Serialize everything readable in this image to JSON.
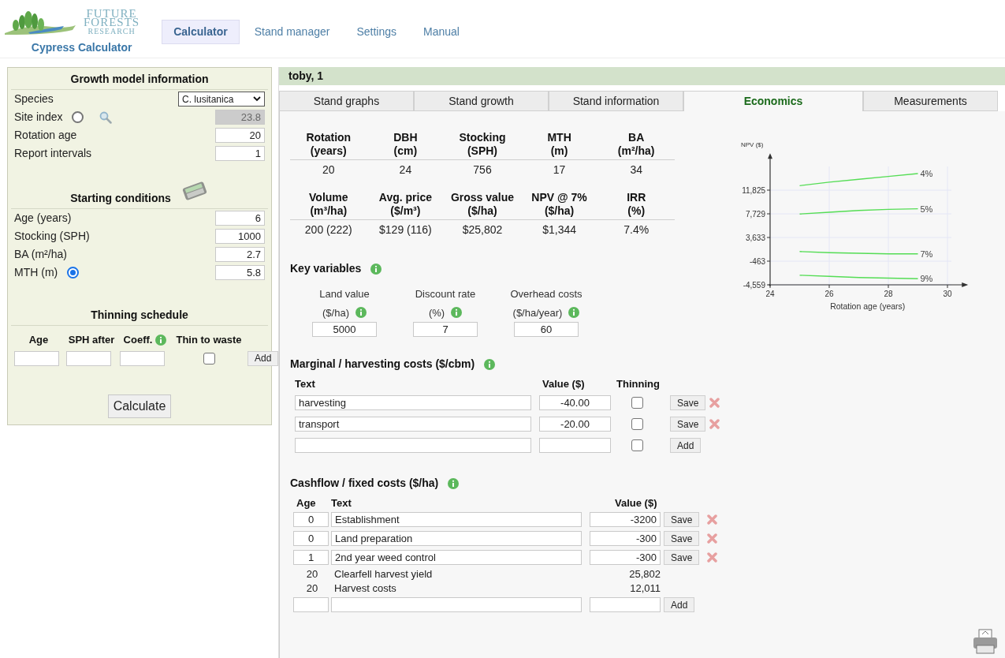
{
  "header": {
    "logo_text": [
      "FUTURE",
      "FORESTS",
      "RESEARCH"
    ],
    "app_title": "Cypress Calculator",
    "nav": [
      {
        "label": "Calculator",
        "selected": true
      },
      {
        "label": "Stand manager",
        "selected": false
      },
      {
        "label": "Settings",
        "selected": false
      },
      {
        "label": "Manual",
        "selected": false
      }
    ]
  },
  "growth_model": {
    "title": "Growth model information",
    "rows": [
      {
        "kind": "select",
        "label": "Species",
        "value": "C. lusitanica"
      },
      {
        "kind": "radio",
        "label": "Site index",
        "selected": false,
        "value": "23.8",
        "search": true
      },
      {
        "kind": "input",
        "label": "Rotation age",
        "value": "20"
      },
      {
        "kind": "input",
        "label": "Report intervals",
        "value": "1"
      }
    ]
  },
  "starting_conditions": {
    "title": "Starting conditions",
    "rows": [
      {
        "kind": "input",
        "label": "Age (years)",
        "value": "6"
      },
      {
        "kind": "input",
        "label": "Stocking (SPH)",
        "value": "1000"
      },
      {
        "kind": "input",
        "label": "BA (m²/ha)",
        "value": "2.7"
      },
      {
        "kind": "radio",
        "label": "MTH (m)",
        "selected": true,
        "value": "5.8"
      }
    ]
  },
  "thinning_schedule": {
    "title": "Thinning schedule",
    "columns": [
      "Age",
      "SPH after",
      "Coeff.",
      "Thin to waste"
    ],
    "thin_to_waste": false,
    "add": "Add"
  },
  "calculate": "Calculate",
  "stand": {
    "title": "toby, 1",
    "tabs": [
      {
        "label": "Stand graphs",
        "selected": false
      },
      {
        "label": "Stand growth",
        "selected": false
      },
      {
        "label": "Stand information",
        "selected": false
      },
      {
        "label": "Economics",
        "selected": true
      },
      {
        "label": "Measurements",
        "selected": false
      }
    ],
    "summary": [
      [
        {
          "heading": [
            "Rotation",
            "(years)"
          ],
          "value": "20"
        },
        {
          "heading": [
            "DBH",
            "(cm)"
          ],
          "value": "24"
        },
        {
          "heading": [
            "Stocking",
            "(SPH)"
          ],
          "value": "756"
        },
        {
          "heading": [
            "MTH",
            "(m)"
          ],
          "value": "17"
        },
        {
          "heading": [
            "BA",
            "(m²/ha)"
          ],
          "value": "34"
        }
      ],
      [
        {
          "heading": [
            "Volume",
            "(m³/ha)"
          ],
          "value": "200 (222)"
        },
        {
          "heading": [
            "Avg. price",
            "($/m³)"
          ],
          "value": "$129 (116)"
        },
        {
          "heading": [
            "Gross value",
            "($/ha)"
          ],
          "value": "$25,802"
        },
        {
          "heading": [
            "NPV @ 7%",
            "($/ha)"
          ],
          "value": "$1,344"
        },
        {
          "heading": [
            "IRR",
            "(%)"
          ],
          "value": "7.4%"
        }
      ]
    ],
    "chart_data": {
      "type": "line",
      "xlabel": "Rotation age (years)",
      "ylabel": "NPV ($)",
      "x": [
        25,
        26,
        27,
        28,
        29
      ],
      "series": [
        {
          "name": "4%",
          "color": "#55dd55",
          "values": [
            12600,
            13200,
            13700,
            14200,
            14700
          ]
        },
        {
          "name": "5%",
          "color": "#55dd55",
          "values": [
            7700,
            8000,
            8300,
            8500,
            8600
          ]
        },
        {
          "name": "7%",
          "color": "#55dd55",
          "values": [
            1200,
            1000,
            900,
            800,
            800
          ]
        },
        {
          "name": "9%",
          "color": "#55dd55",
          "values": [
            -2900,
            -3100,
            -3300,
            -3400,
            -3500
          ]
        }
      ],
      "xlim": [
        24,
        30.7
      ],
      "ylim": [
        -4559,
        18200
      ],
      "grid": true,
      "xticks": [
        24,
        26,
        28,
        30
      ],
      "yticks": [
        {
          "value": -4559,
          "label": "-4,559"
        },
        {
          "value": -463,
          "label": "-463"
        },
        {
          "value": 3633,
          "label": "3,633"
        },
        {
          "value": 7729,
          "label": "7,729"
        },
        {
          "value": 11825,
          "label": "11,825"
        }
      ]
    },
    "key_variables": {
      "title": "Key variables",
      "fields": [
        {
          "label": [
            "Land value",
            "($/ha)"
          ],
          "value": "5000"
        },
        {
          "label": [
            "Discount rate",
            "(%)"
          ],
          "value": "7"
        },
        {
          "label": [
            "Overhead costs",
            "($/ha/year)"
          ],
          "value": "60"
        }
      ]
    },
    "marginal_costs": {
      "title": "Marginal / harvesting costs ($/cbm)",
      "columns": [
        "Text",
        "Value ($)",
        "Thinning"
      ],
      "rows": [
        {
          "kind": "saved",
          "text": "harvesting",
          "value": "-40.00",
          "thinning": false,
          "action": "Save"
        },
        {
          "kind": "saved",
          "text": "transport",
          "value": "-20.00",
          "thinning": false,
          "action": "Save"
        },
        {
          "kind": "new",
          "thinning": false,
          "action": "Add"
        }
      ]
    },
    "cashflow": {
      "title": "Cashflow / fixed costs ($/ha)",
      "columns": [
        "Age",
        "Text",
        "Value ($)"
      ],
      "rows": [
        {
          "kind": "saved",
          "age": "0",
          "text": "Establishment",
          "value": "-3200",
          "action": "Save"
        },
        {
          "kind": "saved",
          "age": "0",
          "text": "Land preparation",
          "value": "-300",
          "action": "Save"
        },
        {
          "kind": "saved",
          "age": "1",
          "text": "2nd year weed control",
          "value": "-300",
          "action": "Save"
        },
        {
          "kind": "fixed",
          "age": "20",
          "text": "Clearfell harvest yield",
          "value": "25,802"
        },
        {
          "kind": "fixed",
          "age": "20",
          "text": "Harvest costs",
          "value": "12,011"
        },
        {
          "kind": "new",
          "action": "Add"
        }
      ]
    }
  }
}
